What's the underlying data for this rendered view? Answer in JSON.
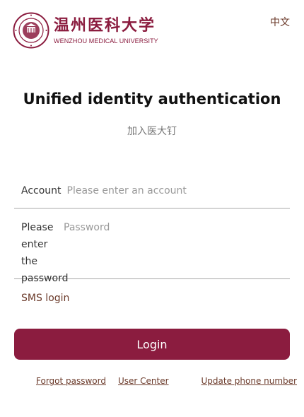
{
  "header": {
    "logo_cn": "温州医科大学",
    "logo_en": "WENZHOU MEDICAL UNIVERSITY",
    "lang_label": "中文"
  },
  "page": {
    "title": "Unified identity authentication",
    "subtitle": "加入医大钉"
  },
  "form": {
    "account_label": "Account",
    "account_placeholder": "Please enter an account",
    "password_label": "Please enter the password",
    "password_placeholder": "Password",
    "sms_label": "SMS login",
    "login_label": "Login"
  },
  "links": {
    "forgot": "Forgot password",
    "user_center": "User Center",
    "update_phone": "Update phone number"
  },
  "colors": {
    "brand": "#8b1c3f",
    "link": "#6b3a2a"
  },
  "icons": [
    "university-seal-icon"
  ]
}
